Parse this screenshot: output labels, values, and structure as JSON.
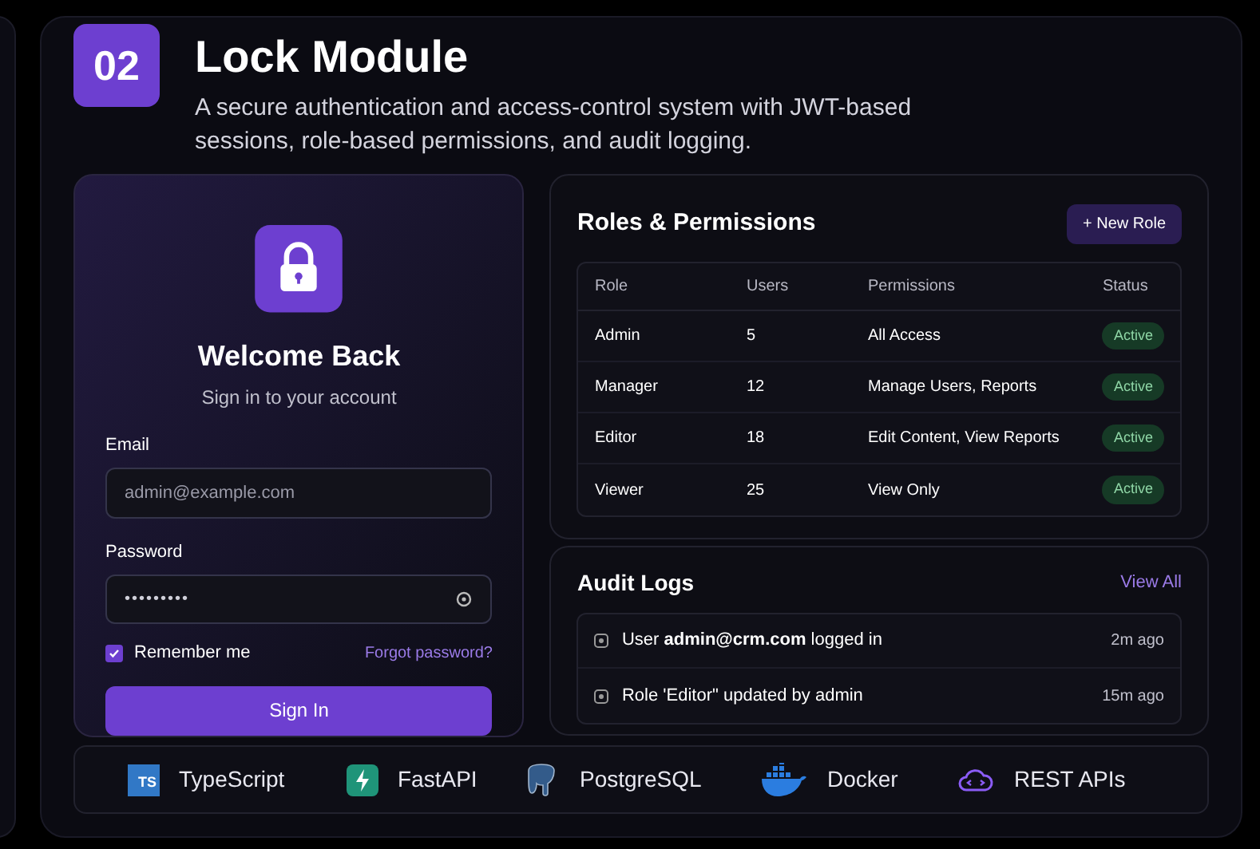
{
  "header": {
    "number": "02",
    "title": "Lock Module",
    "description": "A secure authentication and access-control system with JWT-based sessions, role-based permissions, and audit logging."
  },
  "login": {
    "title": "Welcome Back",
    "subtitle": "Sign in to your account",
    "email": {
      "label": "Email",
      "placeholder": "admin@example.com"
    },
    "password": {
      "label": "Password",
      "value": "•••••••••"
    },
    "remember": {
      "label": "Remember me",
      "checked": true
    },
    "forgot_link": "Forgot password?",
    "submit": "Sign In"
  },
  "roles": {
    "title": "Roles & Permissions",
    "new_button": "+ New Role",
    "columns": [
      "Role",
      "Users",
      "Permissions",
      "Status"
    ],
    "rows": [
      {
        "role": "Admin",
        "users": "5",
        "permissions": "All Access",
        "status": "Active"
      },
      {
        "role": "Manager",
        "users": "12",
        "permissions": "Manage Users, Reports",
        "status": "Active"
      },
      {
        "role": "Editor",
        "users": "18",
        "permissions": "Edit Content, View Reports",
        "status": "Active"
      },
      {
        "role": "Viewer",
        "users": "25",
        "permissions": "View Only",
        "status": "Active"
      }
    ]
  },
  "audit": {
    "title": "Audit Logs",
    "view_all": "View All",
    "entries": [
      {
        "text": "User **admin@crm.com** logged in",
        "time": "2m ago"
      },
      {
        "text": "Role 'Editor\" updated by admin",
        "time": "15m ago"
      }
    ]
  },
  "tech_stack": [
    {
      "kind": "typescript",
      "label": "TypeScript",
      "badge": "TS"
    },
    {
      "kind": "fastapi",
      "label": "FastAPI"
    },
    {
      "kind": "postgres",
      "label": "PostgreSQL"
    },
    {
      "kind": "docker",
      "label": "Docker"
    },
    {
      "kind": "api",
      "label": "REST APIs"
    }
  ]
}
